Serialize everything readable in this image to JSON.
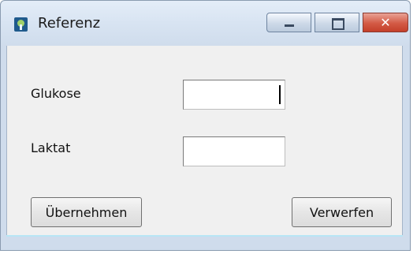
{
  "window": {
    "title": "Referenz",
    "icon": "app-icon",
    "caption_buttons": {
      "minimize": "minimize-icon",
      "maximize": "maximize-icon",
      "close": "close-icon",
      "close_glyph": "✕"
    }
  },
  "form": {
    "fields": [
      {
        "label": "Glukose",
        "value": ""
      },
      {
        "label": "Laktat",
        "value": ""
      }
    ],
    "buttons": {
      "accept": "Übernehmen",
      "discard": "Verwerfen"
    }
  },
  "colors": {
    "client_background": "#f0f0f0",
    "close_button": "#c94b37",
    "titlebar": "#d8e4f2"
  }
}
